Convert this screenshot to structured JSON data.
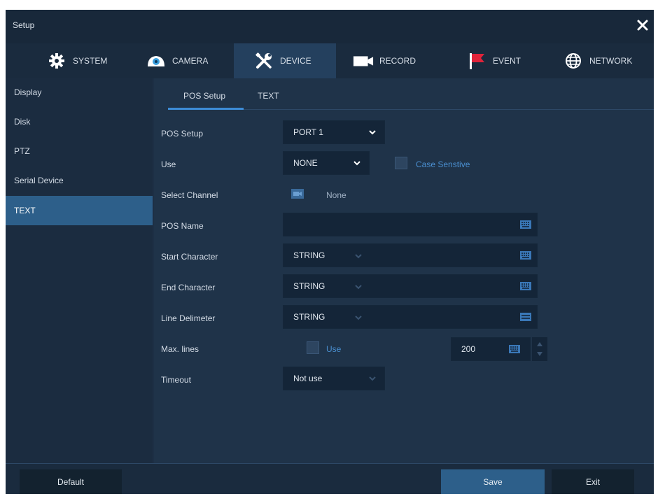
{
  "window": {
    "title": "Setup"
  },
  "tabs": [
    {
      "label": "SYSTEM",
      "icon": "gear-icon"
    },
    {
      "label": "CAMERA",
      "icon": "camera-icon"
    },
    {
      "label": "DEVICE",
      "icon": "tools-icon",
      "active": true
    },
    {
      "label": "RECORD",
      "icon": "video-camera-icon"
    },
    {
      "label": "EVENT",
      "icon": "flag-icon"
    },
    {
      "label": "NETWORK",
      "icon": "globe-icon"
    }
  ],
  "sidebar": {
    "items": [
      {
        "label": "Display"
      },
      {
        "label": "Disk"
      },
      {
        "label": "PTZ"
      },
      {
        "label": "Serial Device"
      },
      {
        "label": "TEXT",
        "active": true
      }
    ]
  },
  "subtabs": [
    {
      "label": "POS Setup",
      "active": true
    },
    {
      "label": "TEXT"
    }
  ],
  "form": {
    "pos_setup": {
      "label": "POS Setup",
      "value": "PORT 1"
    },
    "use": {
      "label": "Use",
      "value": "NONE",
      "case_label": "Case Senstive"
    },
    "select_channel": {
      "label": "Select Channel",
      "value": "None"
    },
    "pos_name": {
      "label": "POS Name",
      "value": ""
    },
    "start_character": {
      "label": "Start Character",
      "value": "STRING"
    },
    "end_character": {
      "label": "End Character",
      "value": "STRING"
    },
    "line_delimeter": {
      "label": "Line Delimeter",
      "value": "STRING"
    },
    "max_lines": {
      "label": "Max. lines",
      "use_label": "Use",
      "value": "200"
    },
    "timeout": {
      "label": "Timeout",
      "value": "Not use"
    }
  },
  "footer": {
    "default_label": "Default",
    "save_label": "Save",
    "exit_label": "Exit"
  },
  "colors": {
    "background": "#1d2f45",
    "accent": "#3d8cd6",
    "sidebar_active": "#2d5f8a",
    "link": "#4a8fd0",
    "event_flag": "#e0233a"
  }
}
